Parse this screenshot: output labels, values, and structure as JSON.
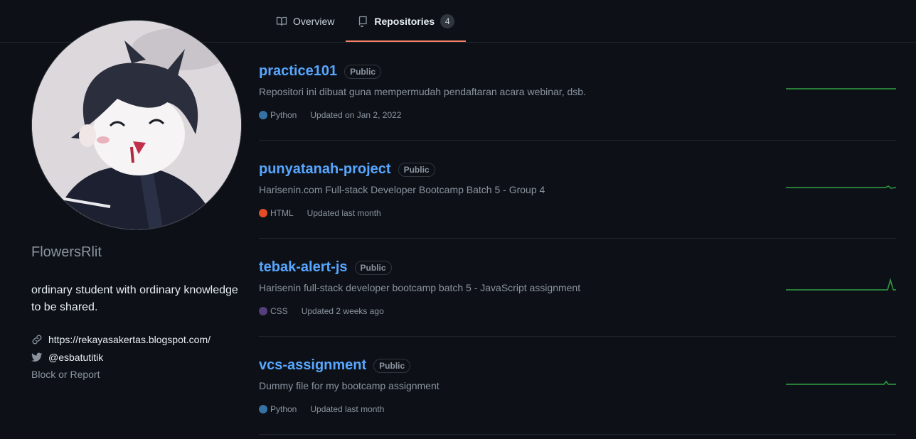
{
  "tabs": [
    {
      "label": "Overview",
      "icon": "book-icon"
    },
    {
      "label": "Repositories",
      "icon": "repo-icon",
      "count": "4"
    }
  ],
  "profile": {
    "username": "FlowersRlit",
    "bio": "ordinary student with ordinary knowledge to be shared.",
    "website": "https://rekayasakertas.blogspot.com/",
    "twitter": "@esbatutitik",
    "block_report": "Block or Report"
  },
  "repos": [
    {
      "name": "practice101",
      "visibility": "Public",
      "description": "Repositori ini dibuat guna mempermudah pendaftaran acara webinar, dsb.",
      "language": "Python",
      "language_color": "#3572A5",
      "updated": "Updated on Jan 2, 2022"
    },
    {
      "name": "punyatanah-project",
      "visibility": "Public",
      "description": "Harisenin.com Full-stack Developer Bootcamp Batch 5 - Group 4",
      "language": "HTML",
      "language_color": "#e34c26",
      "updated": "Updated last month"
    },
    {
      "name": "tebak-alert-js",
      "visibility": "Public",
      "description": "Harisenin full-stack developer bootcamp batch 5 - JavaScript assignment",
      "language": "CSS",
      "language_color": "#563d7c",
      "updated": "Updated 2 weeks ago"
    },
    {
      "name": "vcs-assignment",
      "visibility": "Public",
      "description": "Dummy file for my bootcamp assignment",
      "language": "Python",
      "language_color": "#3572A5",
      "updated": "Updated last month"
    }
  ],
  "colors": {
    "background": "#0d1117",
    "link": "#58a6ff",
    "tab_underline": "#f78166",
    "sparkline": "#2ea043"
  }
}
